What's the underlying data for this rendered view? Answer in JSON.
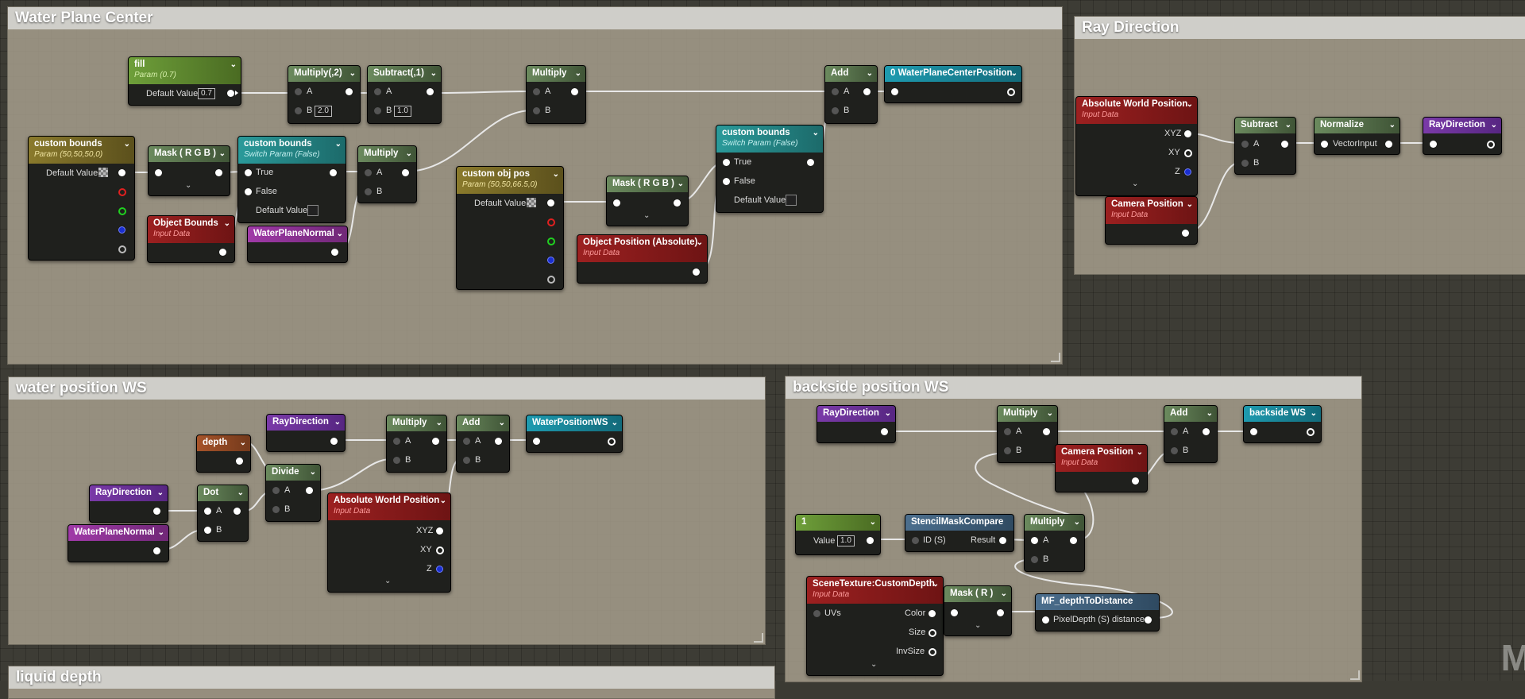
{
  "comments": {
    "water_plane_center": "Water Plane Center",
    "ray_direction": "Ray Direction",
    "water_position_ws": "water position WS",
    "backside_position_ws": "backside position WS",
    "liquid_depth": "liquid depth"
  },
  "nodes": {
    "fill": {
      "title": "fill",
      "sub": "Param (0.7)",
      "default_label": "Default Value",
      "default_value": "0.7"
    },
    "multiply2": {
      "title": "Multiply(,2)",
      "a": "A",
      "b": "B",
      "b_value": "2.0"
    },
    "subtract1": {
      "title": "Subtract(,1)",
      "a": "A",
      "b": "B",
      "b_value": "1.0"
    },
    "multiply_top": {
      "title": "Multiply",
      "a": "A",
      "b": "B"
    },
    "add_top": {
      "title": "Add",
      "a": "A",
      "b": "B"
    },
    "wpc_output": {
      "title": "0 WaterPlaneCenterPosition"
    },
    "custom_bounds_param": {
      "title": "custom bounds",
      "sub": "Param (50,50,50,0)",
      "default_label": "Default Value"
    },
    "mask_rgb_1": {
      "title": "Mask ( R G B )"
    },
    "custom_bounds_switch1": {
      "title": "custom bounds",
      "sub": "Switch Param (False)",
      "true_label": "True",
      "false_label": "False",
      "default_label": "Default Value"
    },
    "multiply_mid": {
      "title": "Multiply",
      "a": "A",
      "b": "B"
    },
    "object_bounds": {
      "title": "Object Bounds",
      "sub": "Input Data"
    },
    "water_plane_normal_1": {
      "title": "WaterPlaneNormal"
    },
    "custom_obj_pos": {
      "title": "custom obj pos",
      "sub": "Param (50,50,66.5,0)",
      "default_label": "Default Value"
    },
    "mask_rgb_2": {
      "title": "Mask ( R G B )"
    },
    "object_position": {
      "title": "Object Position  (Absolute)",
      "sub": "Input Data"
    },
    "custom_bounds_switch2": {
      "title": "custom bounds",
      "sub": "Switch Param (False)",
      "true_label": "True",
      "false_label": "False",
      "default_label": "Default Value"
    },
    "awp_ray": {
      "title": "Absolute World Position",
      "sub": "Input Data",
      "xyz": "XYZ",
      "xy": "XY",
      "z": "Z"
    },
    "camera_position_ray": {
      "title": "Camera Position",
      "sub": "Input Data"
    },
    "subtract_ray": {
      "title": "Subtract",
      "a": "A",
      "b": "B"
    },
    "normalize": {
      "title": "Normalize",
      "input": "VectorInput"
    },
    "ray_direction_out": {
      "title": "RayDirection"
    },
    "ray_direction_1": {
      "title": "RayDirection"
    },
    "depth": {
      "title": "depth"
    },
    "multiply_ws": {
      "title": "Multiply",
      "a": "A",
      "b": "B"
    },
    "add_ws": {
      "title": "Add",
      "a": "A",
      "b": "B"
    },
    "water_position_ws_out": {
      "title": "WaterPositionWS"
    },
    "ray_direction_2": {
      "title": "RayDirection"
    },
    "dot": {
      "title": "Dot",
      "a": "A",
      "b": "B"
    },
    "divide": {
      "title": "Divide",
      "a": "A",
      "b": "B"
    },
    "awp_ws": {
      "title": "Absolute World Position",
      "sub": "Input Data",
      "xyz": "XYZ",
      "xy": "XY",
      "z": "Z"
    },
    "water_plane_normal_2": {
      "title": "WaterPlaneNormal"
    },
    "ray_direction_3": {
      "title": "RayDirection"
    },
    "multiply_bs": {
      "title": "Multiply",
      "a": "A",
      "b": "B"
    },
    "add_bs": {
      "title": "Add",
      "a": "A",
      "b": "B"
    },
    "backside_ws_out": {
      "title": "backside WS"
    },
    "camera_position_bs": {
      "title": "Camera Position",
      "sub": "Input Data"
    },
    "const1": {
      "title": "1",
      "value_label": "Value",
      "value": "1.0"
    },
    "stencil": {
      "title": "StencilMaskCompare",
      "id": "ID (S)",
      "result": "Result"
    },
    "multiply_bs2": {
      "title": "Multiply",
      "a": "A",
      "b": "B"
    },
    "scene_texture": {
      "title": "SceneTexture:CustomDepth",
      "sub": "Input Data",
      "uvs": "UVs",
      "color": "Color",
      "size": "Size",
      "invsize": "InvSize"
    },
    "mask_r": {
      "title": "Mask ( R )"
    },
    "mf_depth": {
      "title": "MF_depthToDistance",
      "input": "PixelDepth (S)",
      "output": "distance"
    }
  },
  "watermark": "M"
}
